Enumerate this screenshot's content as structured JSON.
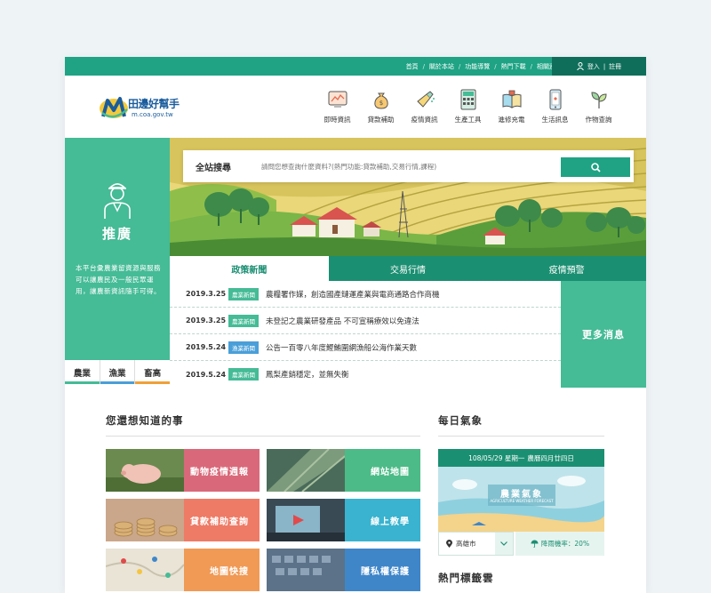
{
  "topnav": {
    "items": [
      "首頁",
      "關於本站",
      "功能導覽",
      "熱門下載",
      "相關連結"
    ],
    "login": "登入",
    "register": "註冊"
  },
  "logo": {
    "name": "田邊好幫手",
    "url": "m.coa.gov.tw"
  },
  "mainnav": [
    {
      "label": "即時資訊",
      "icon": "news-screen-icon"
    },
    {
      "label": "貸款補助",
      "icon": "money-bag-icon"
    },
    {
      "label": "疫情資訊",
      "icon": "spray-bottle-icon"
    },
    {
      "label": "生產工具",
      "icon": "calculator-icon"
    },
    {
      "label": "進修充電",
      "icon": "books-icon"
    },
    {
      "label": "生活訊息",
      "icon": "phone-icon"
    },
    {
      "label": "作物查詢",
      "icon": "sprout-icon"
    }
  ],
  "promo": {
    "title": "推廣",
    "description": "本平台彙農業留資源與服務可以讓農民及一般民眾運用，讓農新資訊隨手可得。",
    "categories": [
      {
        "label": "農業",
        "color": "#45bb96"
      },
      {
        "label": "漁業",
        "color": "#4a9fd8"
      },
      {
        "label": "畜高",
        "color": "#f0a037"
      }
    ]
  },
  "search": {
    "label": "全站搜尋",
    "placeholder": "請問您想查詢什麼資料?(熱門功能:貸款補助,交易行情,課程)"
  },
  "tabs": [
    "政策新聞",
    "交易行情",
    "疫情預警"
  ],
  "news": [
    {
      "date": "2019.3.25",
      "tag": "農業新聞",
      "tag_color": "#45bb96",
      "title": "農糧署作媒，創造國產鏈運產業與電商通路合作商機"
    },
    {
      "date": "2019.3.25",
      "tag": "農業新聞",
      "tag_color": "#45bb96",
      "title": "未登記之農業研發產品 不可宣稱療效以免違法"
    },
    {
      "date": "2019.5.24",
      "tag": "漁業新聞",
      "tag_color": "#4a9fd8",
      "title": "公告一百零八年度鰹鮪圍網漁船公海作業天數"
    },
    {
      "date": "2019.5.24",
      "tag": "農業新聞",
      "tag_color": "#45bb96",
      "title": "鳳梨產銷穩定，並無失衡"
    }
  ],
  "more_label": "更多消息",
  "know": {
    "title": "您還想知道的事",
    "tiles": [
      {
        "label": "動物疫情週報",
        "color": "#d9697a"
      },
      {
        "label": "網站地圖",
        "color": "#4cbb87"
      },
      {
        "label": "貸款補助查詢",
        "color": "#ee7b66"
      },
      {
        "label": "線上教學",
        "color": "#39b3cf"
      },
      {
        "label": "地圖快搜",
        "color": "#f09a56"
      },
      {
        "label": "隱私權保護",
        "color": "#3f86c9"
      }
    ]
  },
  "weather": {
    "title": "每日氣象",
    "date": "108/05/29 星期一",
    "lunar": "農曆四月廿四日",
    "banner_title": "農業氣象",
    "banner_sub": "AGRICULTURE WEATHER FORECAST",
    "city": "高雄市",
    "rain": "降雨機率：20%"
  },
  "tags": {
    "title": "熱門標籤雲"
  }
}
